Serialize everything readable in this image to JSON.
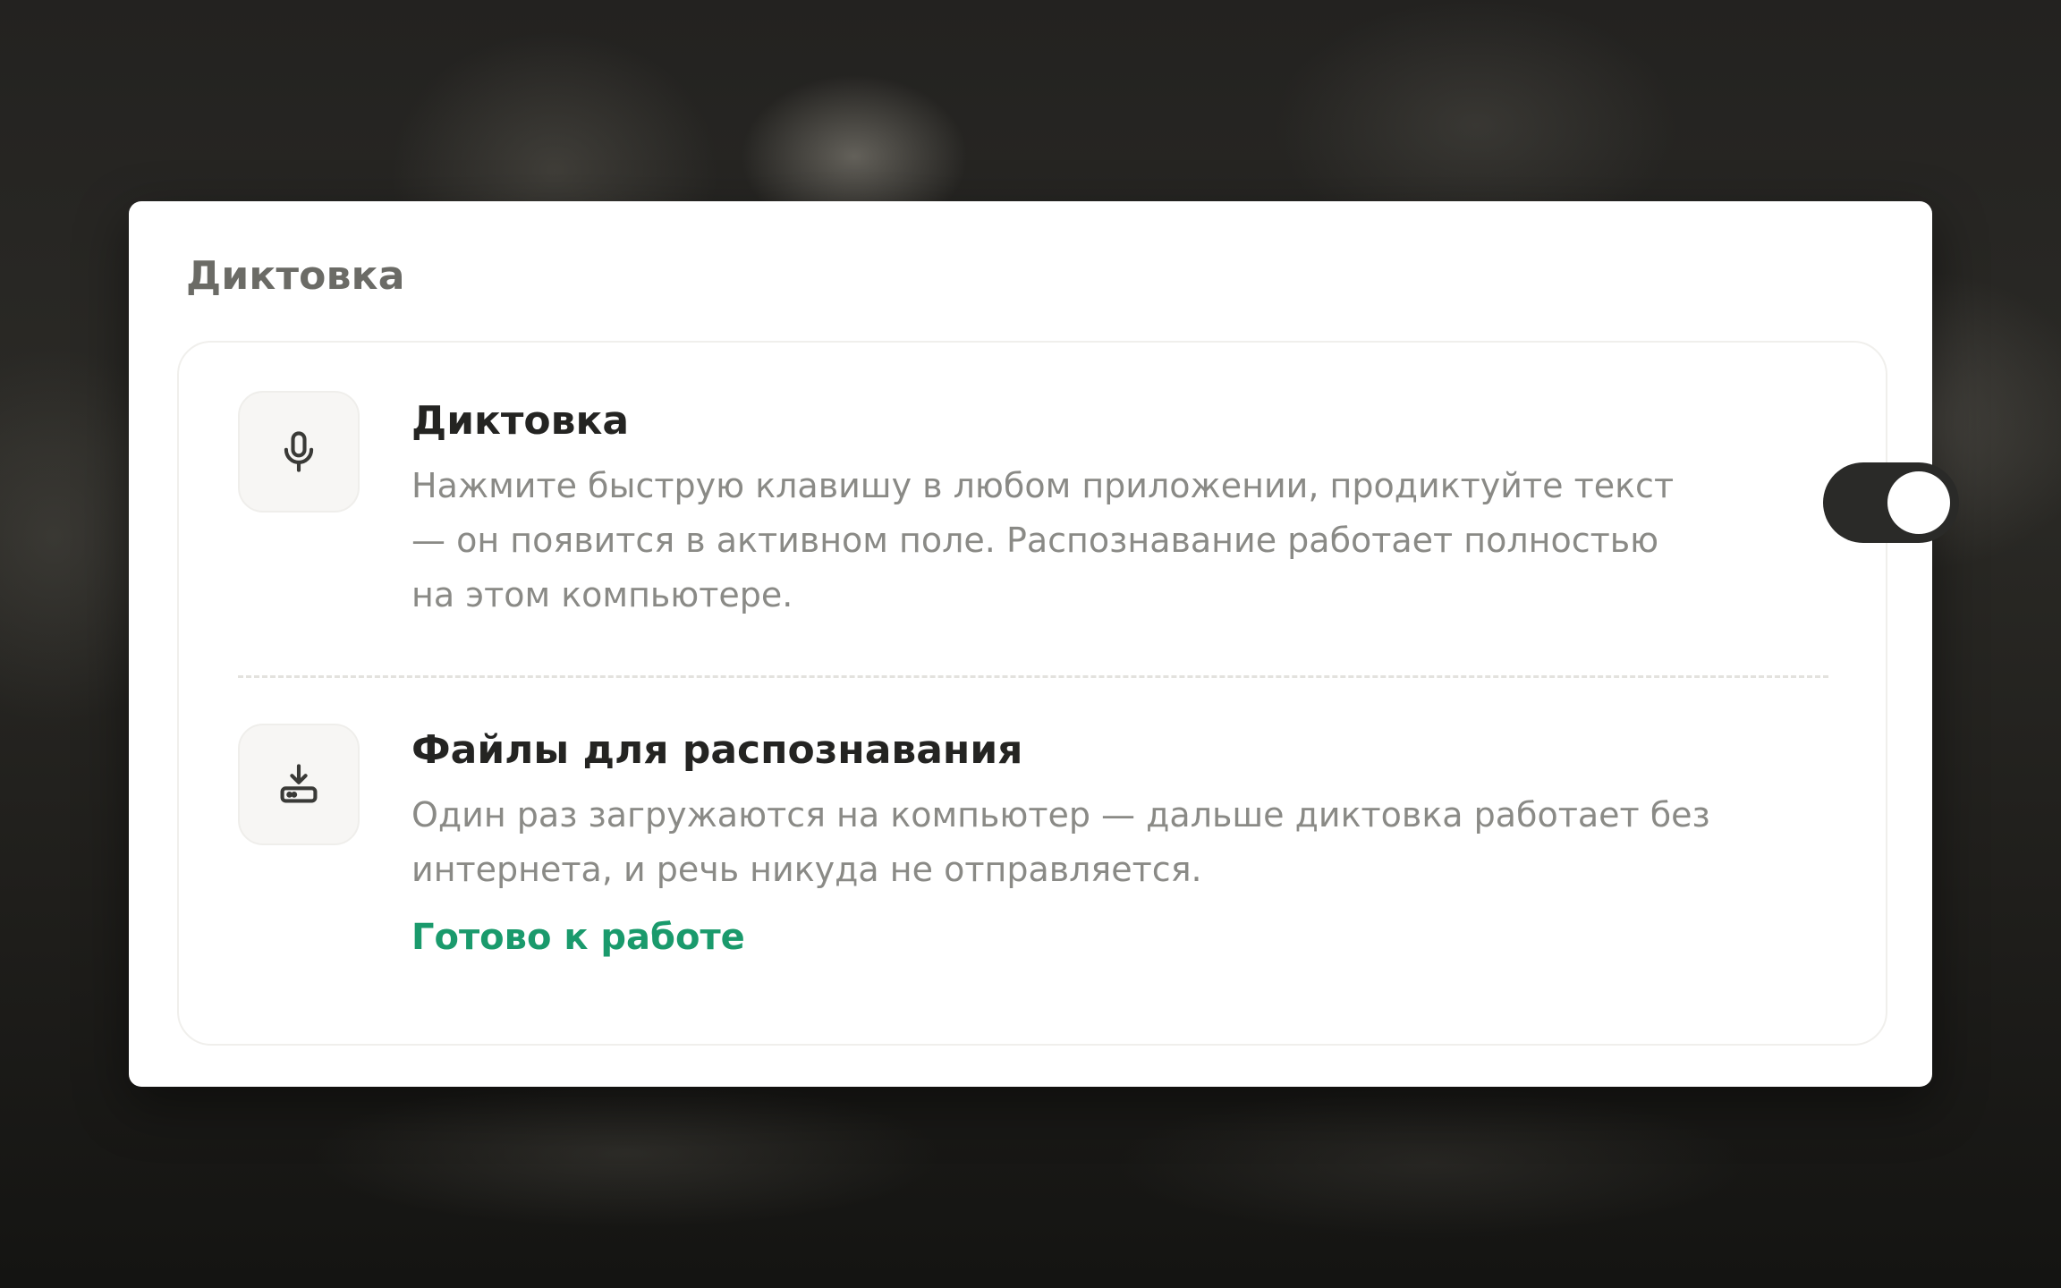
{
  "section": {
    "title": "Диктовка"
  },
  "dictation": {
    "icon": "microphone-icon",
    "title": "Диктовка",
    "description": "Нажмите быструю клавишу в любом приложении, продиктуйте текст — он появится в активном поле. Распознавание работает полностью на этом компьютере.",
    "enabled": true
  },
  "files": {
    "icon": "download-drive-icon",
    "title": "Файлы для распознавания",
    "description": "Один раз загружаются на компьютер — дальше диктовка работает без интернета, и речь никуда не отправляется.",
    "status": "Готово к работе"
  },
  "colors": {
    "status_green": "#1a9a6c",
    "toggle_on": "#2a2a28",
    "title_text": "#242422",
    "description_text": "#8a8a86",
    "section_title": "#6b6b66"
  }
}
